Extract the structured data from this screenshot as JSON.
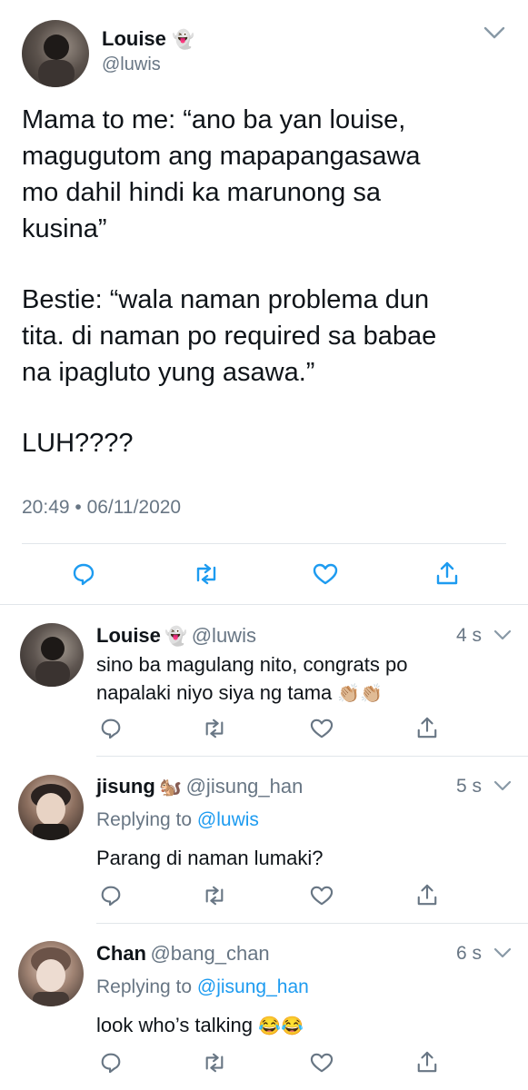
{
  "main_tweet": {
    "name": "Louise",
    "handle": "@luwis",
    "text_lines": [
      "Mama to me: “ano ba yan louise,",
      "magugutom ang mapapangasawa",
      "mo dahil hindi ka marunong sa",
      "kusina”",
      "",
      "Bestie: “wala naman problema dun",
      "tita. di naman po required sa babae",
      "na ipagluto yung asawa.”",
      "",
      "LUH????"
    ],
    "timestamp": "20:49 • 06/11/2020"
  },
  "replies": [
    {
      "name": "Louise",
      "handle": "@luwis",
      "time": "4 s",
      "replying_prefix": "",
      "replying_to": "",
      "text_line1": "sino ba magulang nito, congrats po",
      "text_line2": "napalaki niyo siya ng tama"
    },
    {
      "name": "jisung",
      "handle": "@jisung_han",
      "time": "5 s",
      "replying_prefix": "Replying to",
      "replying_to": "@luwis",
      "text_line1": "Parang di naman lumaki?",
      "text_line2": ""
    },
    {
      "name": "Chan",
      "handle": "@bang_chan",
      "time": "6 s",
      "replying_prefix": "Replying to",
      "replying_to": "@jisung_han",
      "text_line1": "look who’s talking",
      "text_line2": ""
    }
  ],
  "icons": {
    "name_emoji": "ghost-icon",
    "jisung_emoji": "squirrel-icon",
    "clap_emoji": "clapping-hands-icon",
    "laugh_emoji": "tears-of-joy-icon",
    "actions": [
      "reply-icon",
      "retweet-icon",
      "like-icon",
      "share-icon"
    ]
  },
  "colors": {
    "text": "#0f1419",
    "secondary": "#687684",
    "link": "#1d9bf0",
    "divider": "#e1e6ea"
  }
}
